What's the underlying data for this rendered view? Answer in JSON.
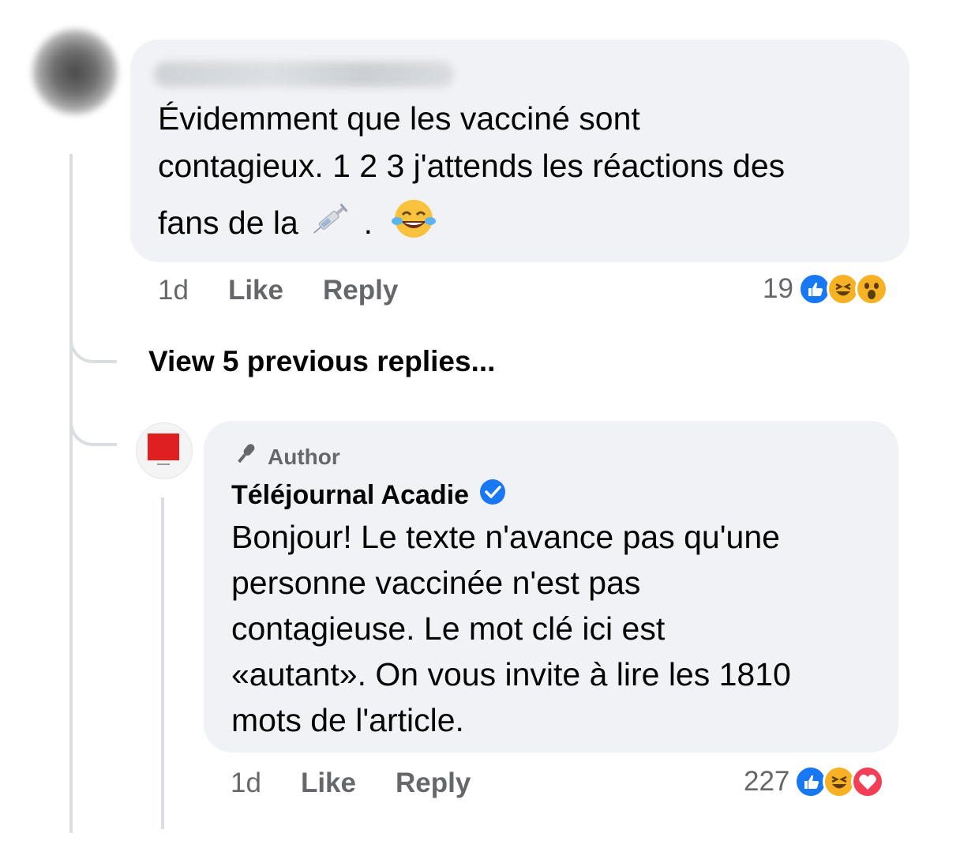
{
  "comment": {
    "text_line1": "Évidemment que les vacciné sont",
    "text_line2": "contagieux. 1 2 3 j'attends les réactions des",
    "text_line3": "fans de la",
    "text_after_emoji": ".",
    "inline_icons": [
      "syringe-emoji",
      "laughing-tears-emoji"
    ],
    "time": "1d",
    "like_label": "Like",
    "reply_label": "Reply",
    "reaction_count": "19",
    "reaction_icons": [
      "like",
      "haha",
      "wow"
    ]
  },
  "view_previous_replies": "View 5 previous replies...",
  "reply": {
    "badge_label": "Author",
    "badge_icon": "microphone-icon",
    "author_name": "Téléjournal Acadie",
    "verified_icon": "verified-badge-icon",
    "text_lines": [
      "Bonjour! Le texte n'avance pas qu'une",
      "personne vaccinée n'est pas",
      "contagieuse. Le mot clé ici est",
      "«autant». On vous invite à lire les 1810",
      "mots de l'article."
    ],
    "time": "1d",
    "like_label": "Like",
    "reply_label": "Reply",
    "reaction_count": "227",
    "reaction_icons": [
      "like",
      "haha",
      "love"
    ]
  },
  "colors": {
    "bubble": "#f0f2f5",
    "meta_text": "#65676b",
    "like_blue": "#1877f2",
    "haha_yellow": "#f7b125",
    "love_red": "#f33e58",
    "verified_blue": "#1877f2"
  }
}
